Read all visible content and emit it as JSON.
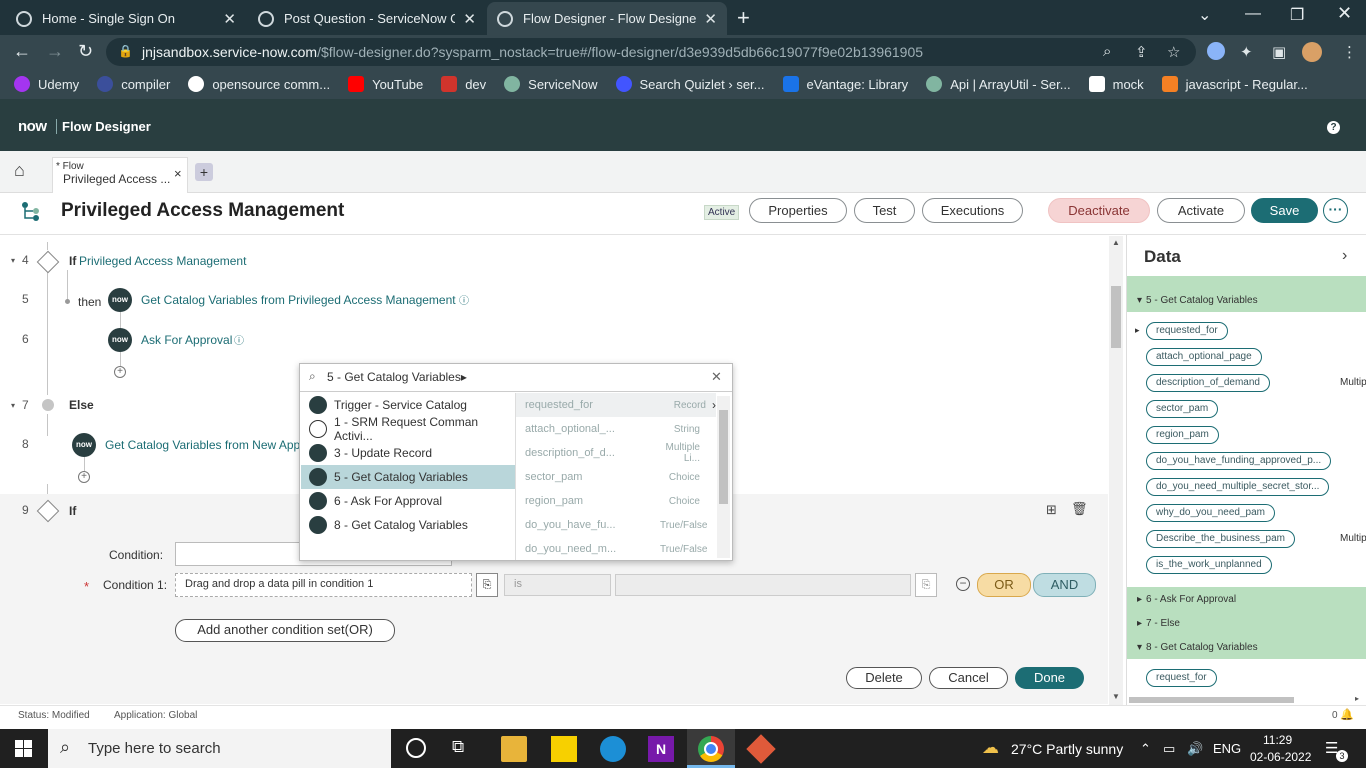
{
  "browser": {
    "tabs": [
      {
        "title": "Home - Single Sign On"
      },
      {
        "title": "Post Question - ServiceNow Com"
      },
      {
        "title": "Flow Designer - Flow Designer : F"
      }
    ],
    "new_tab": "+",
    "url_host": "jnjsandbox.service-now.com",
    "url_path": "/$flow-designer.do?sysparm_nostack=true#/flow-designer/d3e939d5db66c19077f9e02b13961905",
    "bookmarks": [
      {
        "label": "Udemy",
        "color": "#a435f0"
      },
      {
        "label": "compiler",
        "color": "#3b4f9b"
      },
      {
        "label": "opensource comm...",
        "color": "#ffffff"
      },
      {
        "label": "YouTube",
        "color": "#ff0000"
      },
      {
        "label": "dev",
        "color": "#d0342c"
      },
      {
        "label": "ServiceNow",
        "color": "#81b5a1"
      },
      {
        "label": "Search Quizlet › ser...",
        "color": "#4255ff"
      },
      {
        "label": "eVantage: Library",
        "color": "#1a73e8"
      },
      {
        "label": "Api | ArrayUtil - Ser...",
        "color": "#81b5a1"
      },
      {
        "label": "mock",
        "color": "#ffffff"
      },
      {
        "label": "javascript - Regular...",
        "color": "#f48024"
      }
    ]
  },
  "app": {
    "logo": "now",
    "name": "Flow Designer",
    "help": "?"
  },
  "flow_tab": {
    "sub": "* Flow",
    "name": "Privileged Access ...",
    "close": "×",
    "add": "+"
  },
  "header": {
    "title": "Privileged Access Management",
    "status": "Active",
    "buttons": {
      "properties": "Properties",
      "test": "Test",
      "executions": "Executions",
      "deactivate": "Deactivate",
      "activate": "Activate",
      "save": "Save",
      "more": "···"
    }
  },
  "steps": [
    {
      "num": "4",
      "keyword": "If",
      "text": "Privileged Access Management"
    },
    {
      "num": "5",
      "keyword": "then",
      "text": "Get Catalog Variables from Privileged Access Management"
    },
    {
      "num": "6",
      "keyword": "",
      "text": "Ask For Approval"
    },
    {
      "num": "7",
      "keyword": "Else",
      "text": ""
    },
    {
      "num": "8",
      "keyword": "",
      "text": "Get Catalog Variables from New App"
    },
    {
      "num": "9",
      "keyword": "If",
      "text": ""
    }
  ],
  "condition_editor": {
    "condition_label": "Condition:",
    "condition1_label": "Condition 1:",
    "required_mark": "*",
    "drag_placeholder": "Drag and drop a data pill in condition 1",
    "operator": "is",
    "or": "OR",
    "and": "AND",
    "add_condition_set": "Add another condition set(OR)",
    "delete": "Delete",
    "cancel": "Cancel",
    "done": "Done"
  },
  "picker": {
    "search_value": "5 - Get Catalog Variables▸",
    "sources": [
      {
        "label": "Trigger - Service Catalog"
      },
      {
        "label": "1 - SRM Request Comman Activi..."
      },
      {
        "label": "3 - Update Record"
      },
      {
        "label": "5 - Get Catalog Variables"
      },
      {
        "label": "6 - Ask For Approval"
      },
      {
        "label": "8 - Get Catalog Variables"
      }
    ],
    "selected_index": 3,
    "variables": [
      {
        "name": "requested_for",
        "type": "Record"
      },
      {
        "name": "attach_optional_...",
        "type": "String"
      },
      {
        "name": "description_of_d...",
        "type": "Multiple Li..."
      },
      {
        "name": "sector_pam",
        "type": "Choice"
      },
      {
        "name": "region_pam",
        "type": "Choice"
      },
      {
        "name": "do_you_have_fu...",
        "type": "True/False"
      },
      {
        "name": "do_you_need_m...",
        "type": "True/False"
      }
    ]
  },
  "data_panel": {
    "title": "Data",
    "section_5": "5 - Get Catalog Variables",
    "pills_5": [
      {
        "label": "requested_for",
        "side": ""
      },
      {
        "label": "attach_optional_page",
        "side": ""
      },
      {
        "label": "description_of_demand",
        "side": "Multip"
      },
      {
        "label": "sector_pam",
        "side": ""
      },
      {
        "label": "region_pam",
        "side": ""
      },
      {
        "label": "do_you_have_funding_approved_p...",
        "side": ""
      },
      {
        "label": "do_you_need_multiple_secret_stor...",
        "side": ""
      },
      {
        "label": "why_do_you_need_pam",
        "side": ""
      },
      {
        "label": "Describe_the_business_pam",
        "side": "Multip"
      },
      {
        "label": "is_the_work_unplanned",
        "side": ""
      }
    ],
    "section_6": "6 - Ask For Approval",
    "section_7": "7 - Else",
    "section_8": "8 - Get Catalog Variables",
    "pills_8": [
      {
        "label": "request_for"
      }
    ]
  },
  "status": {
    "status_text": "Status: Modified",
    "application_text": "Application: Global",
    "right": "0"
  },
  "taskbar": {
    "search_placeholder": "Type here to search",
    "weather": "27°C  Partly sunny",
    "lang": "ENG",
    "time": "11:29",
    "date": "02-06-2022",
    "notifications": "3"
  }
}
